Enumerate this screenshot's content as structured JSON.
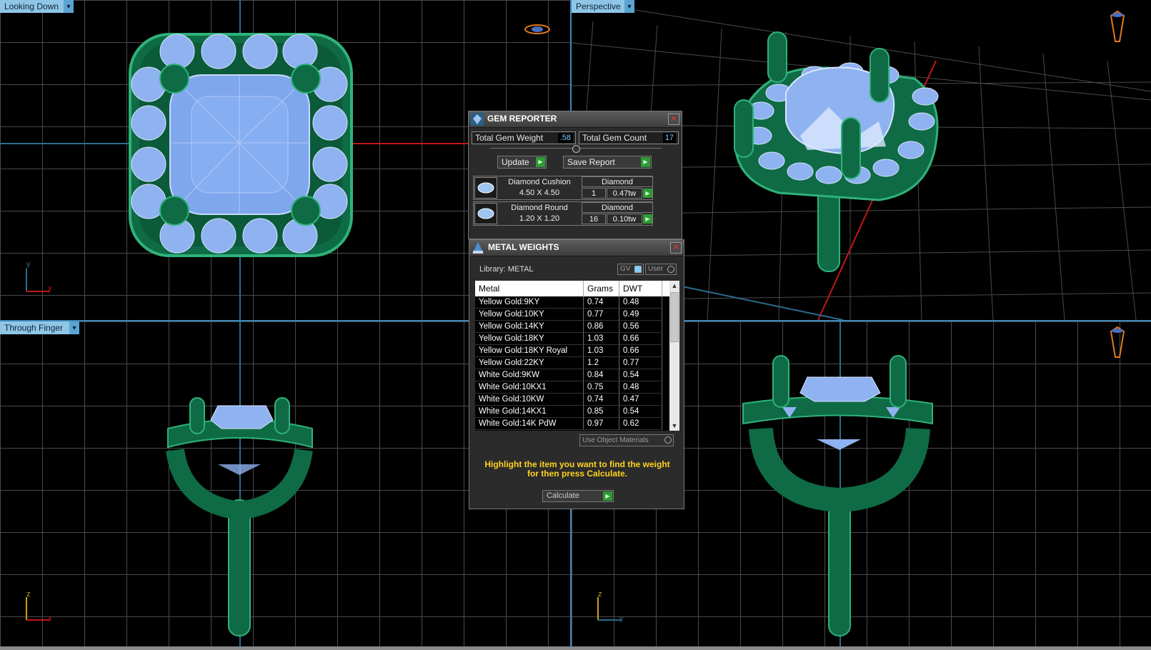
{
  "viewports": {
    "top_left": {
      "label": "Looking Down"
    },
    "top_right": {
      "label": "Perspective"
    },
    "bottom_left": {
      "label": "Through Finger"
    },
    "bottom_right": {
      "label": ""
    }
  },
  "axes": {
    "x": "x",
    "y": "y",
    "z": "z"
  },
  "gem_reporter": {
    "title": "GEM REPORTER",
    "total_weight_label": "Total Gem Weight",
    "total_weight_value": ".58",
    "total_count_label": "Total Gem Count",
    "total_count_value": "17",
    "update_label": "Update",
    "save_label": "Save Report",
    "gems": [
      {
        "name": "Diamond Cushion",
        "material": "Diamond",
        "size": "4.50 X 4.50",
        "count": "1",
        "weight": "0.47tw"
      },
      {
        "name": "Diamond Round",
        "material": "Diamond",
        "size": "1.20 X 1.20",
        "count": "16",
        "weight": "0.10tw"
      }
    ]
  },
  "metal_weights": {
    "title": "METAL WEIGHTS",
    "library_label": "Library: METAL",
    "gv_label": "GV",
    "user_label": "User",
    "columns": [
      "Metal",
      "Grams",
      "DWT"
    ],
    "rows": [
      {
        "metal": "Yellow Gold:9KY",
        "grams": "0.74",
        "dwt": "0.48"
      },
      {
        "metal": "Yellow Gold:10KY",
        "grams": "0.77",
        "dwt": "0.49"
      },
      {
        "metal": "Yellow Gold:14KY",
        "grams": "0.86",
        "dwt": "0.56"
      },
      {
        "metal": "Yellow Gold:18KY",
        "grams": "1.03",
        "dwt": "0.66"
      },
      {
        "metal": "Yellow Gold:18KY Royal",
        "grams": "1.03",
        "dwt": "0.66"
      },
      {
        "metal": "Yellow Gold:22KY",
        "grams": "1.2",
        "dwt": "0.77"
      },
      {
        "metal": "White Gold:9KW",
        "grams": "0.84",
        "dwt": "0.54"
      },
      {
        "metal": "White Gold:10KX1",
        "grams": "0.75",
        "dwt": "0.48"
      },
      {
        "metal": "White Gold:10KW",
        "grams": "0.74",
        "dwt": "0.47"
      },
      {
        "metal": "White Gold:14KX1",
        "grams": "0.85",
        "dwt": "0.54"
      },
      {
        "metal": "White Gold:14K PdW",
        "grams": "0.97",
        "dwt": "0.62"
      }
    ],
    "use_object_materials_label": "Use Object Materials",
    "hint": "Highlight the item you want to find the weight for then press Calculate.",
    "calculate_label": "Calculate"
  },
  "colors": {
    "metal": "#0e6b45",
    "gem": "#8fb2f0",
    "accent": "#8fc6e6",
    "hint": "#ffd21f"
  }
}
